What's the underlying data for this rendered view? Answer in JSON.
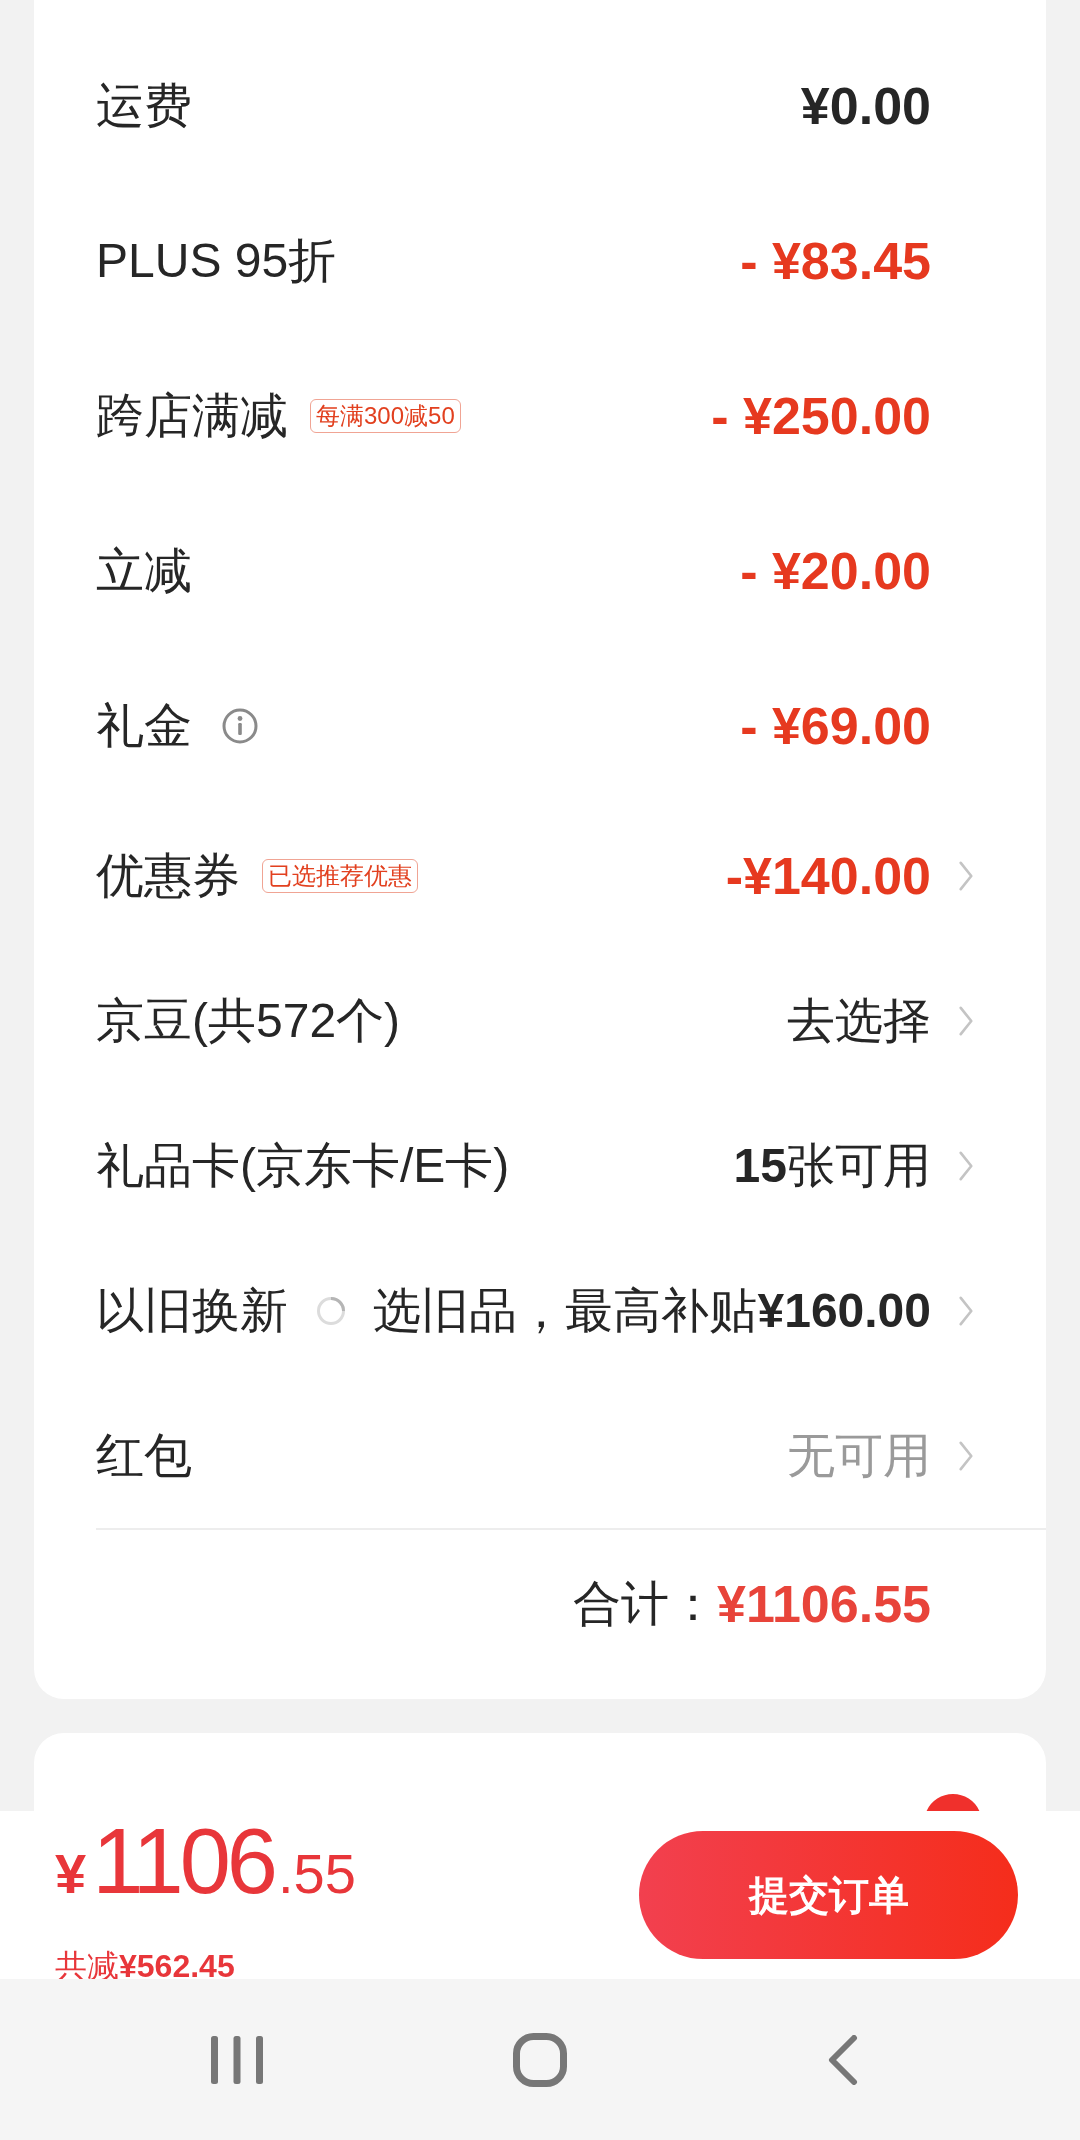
{
  "price_rows": [
    {
      "label": "运费",
      "kind": "plain",
      "value": "¥0.00",
      "arrow": false
    },
    {
      "label": "PLUS 95折",
      "kind": "discount",
      "value": "- ¥83.45",
      "arrow": false
    },
    {
      "label": "跨店满减",
      "tag": "每满300减50",
      "kind": "discount",
      "value": "- ¥250.00",
      "arrow": false
    },
    {
      "label": "立减",
      "kind": "discount",
      "value": "- ¥20.00",
      "arrow": false
    },
    {
      "label": "礼金",
      "info": true,
      "kind": "discount",
      "value": "- ¥69.00",
      "arrow": false
    },
    {
      "label": "优惠券",
      "tag": "已选推荐优惠",
      "kind": "discount",
      "value": "-¥140.00",
      "arrow": true
    },
    {
      "label": "京豆(共572个)",
      "kind": "action",
      "value": "去选择",
      "arrow": true
    },
    {
      "label": "礼品卡(京东卡/E卡)",
      "kind": "action",
      "value": "**15**张可用",
      "arrow": true
    },
    {
      "label": "以旧换新",
      "kind": "trade_in",
      "value": "选旧品，最高补贴**¥160.00**",
      "arrow": true
    },
    {
      "label": "红包",
      "kind": "unavailable",
      "value": "无可用",
      "arrow": true
    }
  ],
  "total": {
    "label": "合计：",
    "value": "¥1106.55"
  },
  "checkout": {
    "currency": "¥",
    "amount_integer": "1106",
    "amount_decimal": ".55",
    "savings": "共减**¥562.45**",
    "submit_label": "提交订单"
  }
}
